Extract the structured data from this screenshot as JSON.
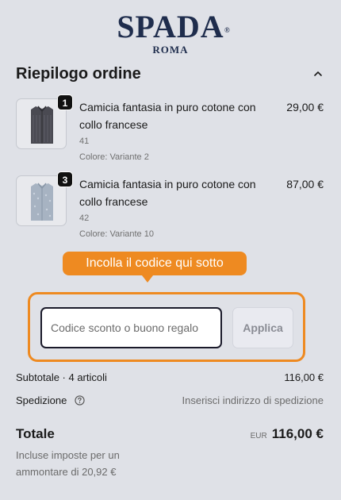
{
  "brand": {
    "name": "SPADA",
    "reg_mark": "®",
    "city": "ROMA"
  },
  "summary": {
    "title": "Riepilogo ordine",
    "toggle_icon": "chevron-up-icon"
  },
  "items": [
    {
      "quantity": "1",
      "name": "Camicia fantasia in puro cotone con collo francese",
      "size": "41",
      "color": "Colore: Variante 2",
      "price": "29,00 €",
      "shirt_color": "#4a4a52"
    },
    {
      "quantity": "3",
      "name": "Camicia fantasia in puro cotone con collo francese",
      "size": "42",
      "color": "Colore: Variante 10",
      "price": "87,00 €",
      "shirt_color": "#a7b3c2"
    }
  ],
  "discount": {
    "tooltip": "Incolla il codice qui sotto",
    "placeholder": "Codice sconto o buono regalo",
    "value": "",
    "apply_label": "Applica",
    "accent": "#ee8a21"
  },
  "totals": {
    "subtotal_label": "Subtotale · 4 articoli",
    "subtotal_value": "116,00 €",
    "shipping_label": "Spedizione",
    "shipping_value": "Inserisci indirizzo di spedizione",
    "total_label": "Totale",
    "currency": "EUR",
    "total_value": "116,00 €",
    "tax_note": "Incluse imposte per un ammontare di 20,92 €"
  }
}
